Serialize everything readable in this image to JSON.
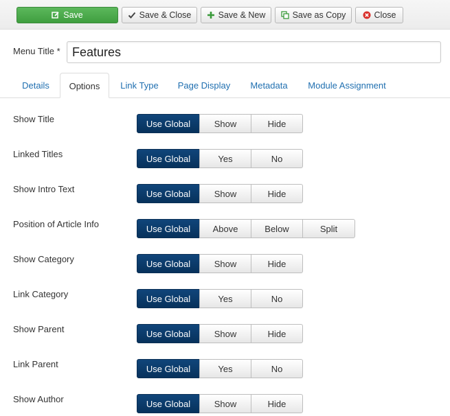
{
  "toolbar": {
    "save": "Save",
    "save_close": "Save & Close",
    "save_new": "Save & New",
    "save_copy": "Save as Copy",
    "close": "Close"
  },
  "menu_title": {
    "label": "Menu Title *",
    "value": "Features"
  },
  "tabs": [
    "Details",
    "Options",
    "Link Type",
    "Page Display",
    "Metadata",
    "Module Assignment"
  ],
  "active_tab": "Options",
  "options": [
    {
      "label": "Show Title",
      "choices": [
        "Use Global",
        "Show",
        "Hide"
      ],
      "selected": "Use Global"
    },
    {
      "label": "Linked Titles",
      "choices": [
        "Use Global",
        "Yes",
        "No"
      ],
      "selected": "Use Global"
    },
    {
      "label": "Show Intro Text",
      "choices": [
        "Use Global",
        "Show",
        "Hide"
      ],
      "selected": "Use Global"
    },
    {
      "label": "Position of Article Info",
      "choices": [
        "Use Global",
        "Above",
        "Below",
        "Split"
      ],
      "selected": "Use Global"
    },
    {
      "label": "Show Category",
      "choices": [
        "Use Global",
        "Show",
        "Hide"
      ],
      "selected": "Use Global"
    },
    {
      "label": "Link Category",
      "choices": [
        "Use Global",
        "Yes",
        "No"
      ],
      "selected": "Use Global"
    },
    {
      "label": "Show Parent",
      "choices": [
        "Use Global",
        "Show",
        "Hide"
      ],
      "selected": "Use Global"
    },
    {
      "label": "Link Parent",
      "choices": [
        "Use Global",
        "Yes",
        "No"
      ],
      "selected": "Use Global"
    },
    {
      "label": "Show Author",
      "choices": [
        "Use Global",
        "Show",
        "Hide"
      ],
      "selected": "Use Global"
    }
  ],
  "colors": {
    "save_green": "#4cae4c",
    "selected_navy": "#0b3a66",
    "tab_link": "#1f6fb0",
    "close_icon_red": "#d9302b"
  },
  "icons": {
    "save": "edit-icon",
    "save_close": "checkmark-icon",
    "save_new": "plus-icon",
    "save_copy": "copy-icon",
    "close": "close-circle-icon"
  }
}
